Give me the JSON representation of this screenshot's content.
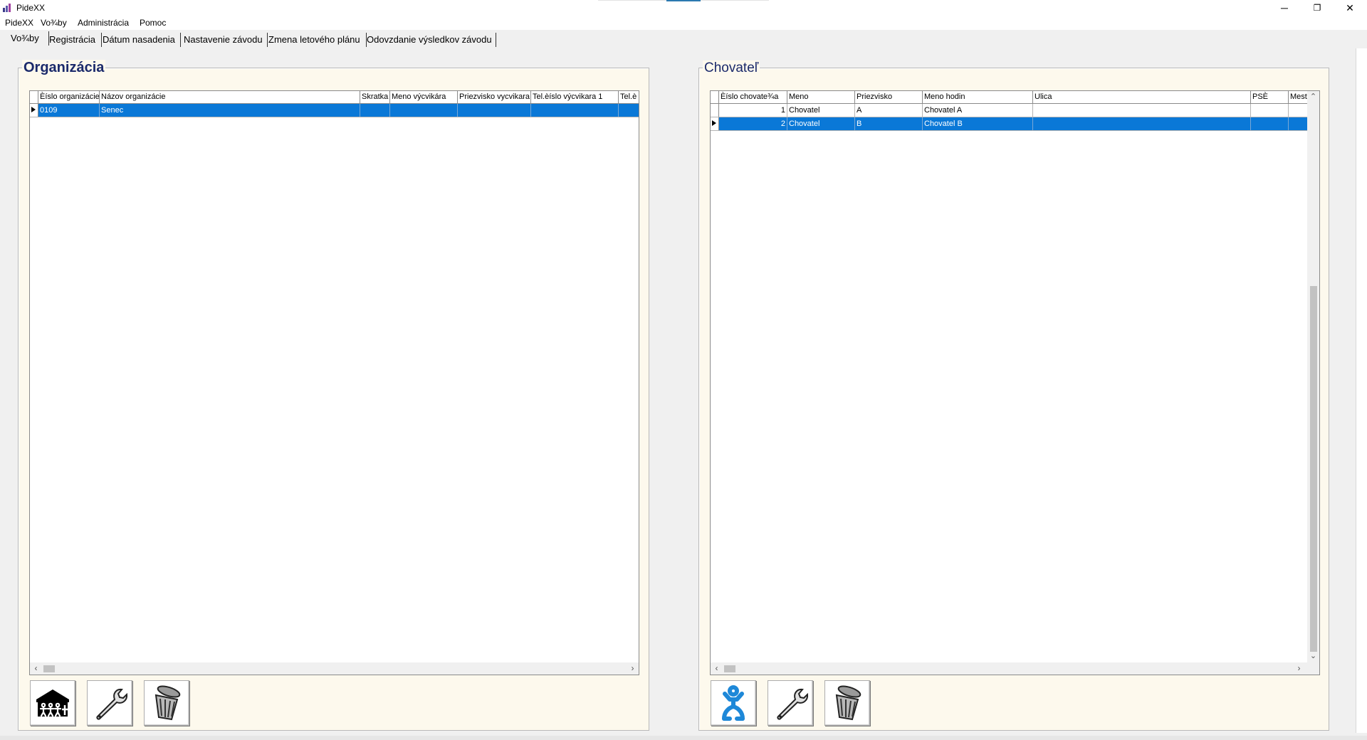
{
  "window": {
    "title": "PideXX",
    "minimize_glyph": "─",
    "restore_glyph": "❐",
    "close_glyph": "✕"
  },
  "menu": [
    "PideXX",
    "Vo¾by",
    "Administrácia",
    "Pomoc"
  ],
  "tabs": [
    "Vo¾by",
    "Registrácia",
    "Dátum nasadenia",
    "Nastavenie závodu",
    "Zmena letového plánu",
    "Odovzdanie výsledkov závodu"
  ],
  "active_tab": "Vo¾by",
  "organizacia": {
    "title": "Organizácia",
    "columns": [
      "Èíslo organizácie",
      "Názov organizácie",
      "Skratka",
      "Meno výcvikára",
      "Priezvisko vycvikara",
      "Tel.èíslo výcvikara 1",
      "Tel.è"
    ],
    "rows": [
      [
        "0109",
        "Senec",
        "",
        "",
        "",
        "",
        ""
      ]
    ],
    "selected_row": 0,
    "buttons": [
      {
        "name": "add-organization-button",
        "icon": "house-people-icon"
      },
      {
        "name": "edit-organization-button",
        "icon": "wrench-icon"
      },
      {
        "name": "delete-organization-button",
        "icon": "trash-can-icon"
      }
    ]
  },
  "chovatel": {
    "title": "Chovateľ",
    "columns": [
      "Èíslo chovate¾a",
      "Meno",
      "Priezvisko",
      "Meno hodin",
      "Ulica",
      "PSÈ",
      "Mest"
    ],
    "rows": [
      [
        "1",
        "Chovatel",
        "A",
        "Chovatel A",
        "",
        "",
        ""
      ],
      [
        "2",
        "Chovatel",
        "B",
        "Chovatel B",
        "",
        "",
        ""
      ]
    ],
    "selected_row": 1,
    "buttons": [
      {
        "name": "add-breeder-button",
        "icon": "person-icon"
      },
      {
        "name": "edit-breeder-button",
        "icon": "wrench-icon"
      },
      {
        "name": "delete-breeder-button",
        "icon": "trash-can-icon"
      }
    ]
  },
  "scroll_glyphs": {
    "left": "‹",
    "right": "›",
    "up": "⌃",
    "down": "⌄"
  },
  "colors": {
    "selection": "#0a78d7",
    "panel_background": "#fdf9ed",
    "panel_title": "#1b2a6b",
    "person_icon": "#1e88d8"
  }
}
